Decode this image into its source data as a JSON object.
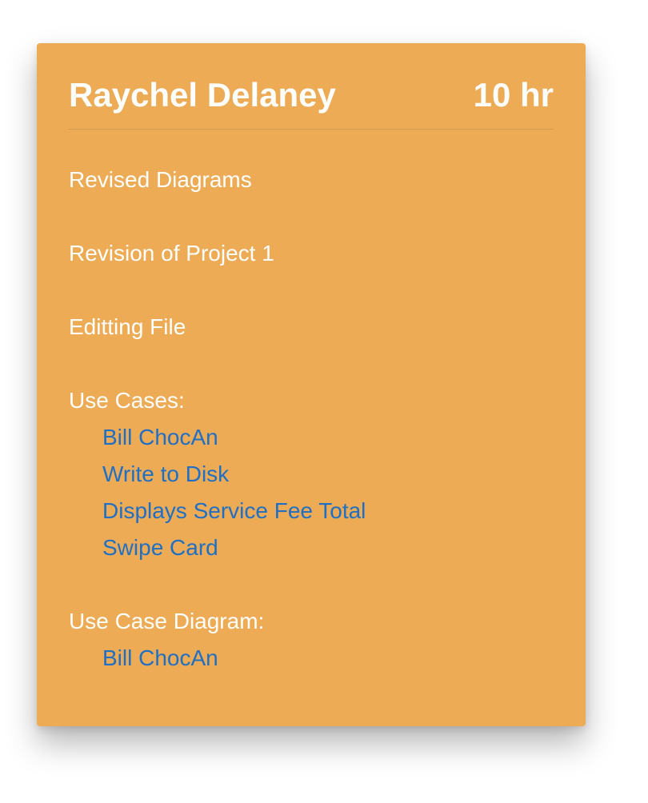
{
  "card": {
    "name": "Raychel Delaney",
    "hours": "10 hr",
    "tasks": [
      "Revised Diagrams",
      "Revision of Project 1",
      "Editting File"
    ],
    "use_cases": {
      "label": "Use Cases:",
      "links": [
        "Bill ChocAn",
        "Write to Disk",
        "Displays Service Fee Total",
        "Swipe Card"
      ]
    },
    "use_case_diagram": {
      "label": "Use Case Diagram:",
      "links": [
        "Bill ChocAn"
      ]
    }
  },
  "colors": {
    "card_background": "#edab55",
    "link": "#1f6fc4",
    "text": "#ffffff"
  }
}
